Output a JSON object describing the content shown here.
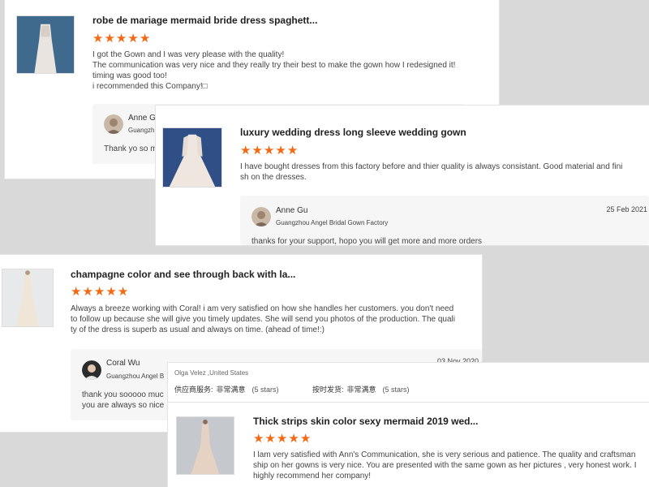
{
  "reviews": [
    {
      "title": "robe de mariage mermaid bride dress spaghett...",
      "stars": [
        "★",
        "★",
        "★",
        "★",
        "★"
      ],
      "text": "I got the Gown and I was very please with the quality!\nThe communication was very nice and they really try their best to make the gown how I redesigned it!\ntiming was good too!\ni recommended this Company!□",
      "reply": {
        "name": "Anne G",
        "company": "Guangzh",
        "text": "Thank yo so m"
      }
    },
    {
      "title": "luxury wedding dress long sleeve wedding gown",
      "stars": [
        "★",
        "★",
        "★",
        "★",
        "★"
      ],
      "text": "I have bought dresses from this factory before and thier quality is always consistant. Good material and fini\nsh on the dresses.",
      "reply": {
        "name": "Anne Gu",
        "company": "Guangzhou Angel Bridal Gown Factory",
        "date": "25 Feb 2021",
        "text": "thanks for your support, hopo you will get more and more orders"
      }
    },
    {
      "title": "champagne color and see through back with la...",
      "stars": [
        "★",
        "★",
        "★",
        "★",
        "★"
      ],
      "text": "Always a breeze working with Coral! i am very satisfied on how she handles her customers. you don't need\nto follow up because she will give you timely updates. She will send you photos of the production. The quali\nty of the dress is superb as usual and always on time. (ahead of time!:)",
      "reply": {
        "name": "Coral Wu",
        "company": "Guangzhou Angel B",
        "date": "03 Nov 2020",
        "text": "thank you sooooo muc\nyou are always so  nice"
      }
    },
    {
      "reviewer": "Olga Velez ,United States",
      "ratings": [
        {
          "label": "供应商服务:",
          "value": "非常满意",
          "count": "(5 stars)"
        },
        {
          "label": "按时发货:",
          "value": "非常满意",
          "count": "(5 stars)"
        }
      ],
      "title": "Thick strips skin color sexy mermaid 2019 wed...",
      "stars": [
        "★",
        "★",
        "★",
        "★",
        "★"
      ],
      "text": "I lam very satisfied with Ann's Communication, she is very serious and patience. The quality and craftsman\nship on her gowns is very nice. You are presented with the same gown as her pictures , very honest work. I\nhighly recommend her company!"
    }
  ],
  "colors": {
    "star": "#f26a13",
    "background": "#d9d9d9",
    "card": "#ffffff"
  }
}
